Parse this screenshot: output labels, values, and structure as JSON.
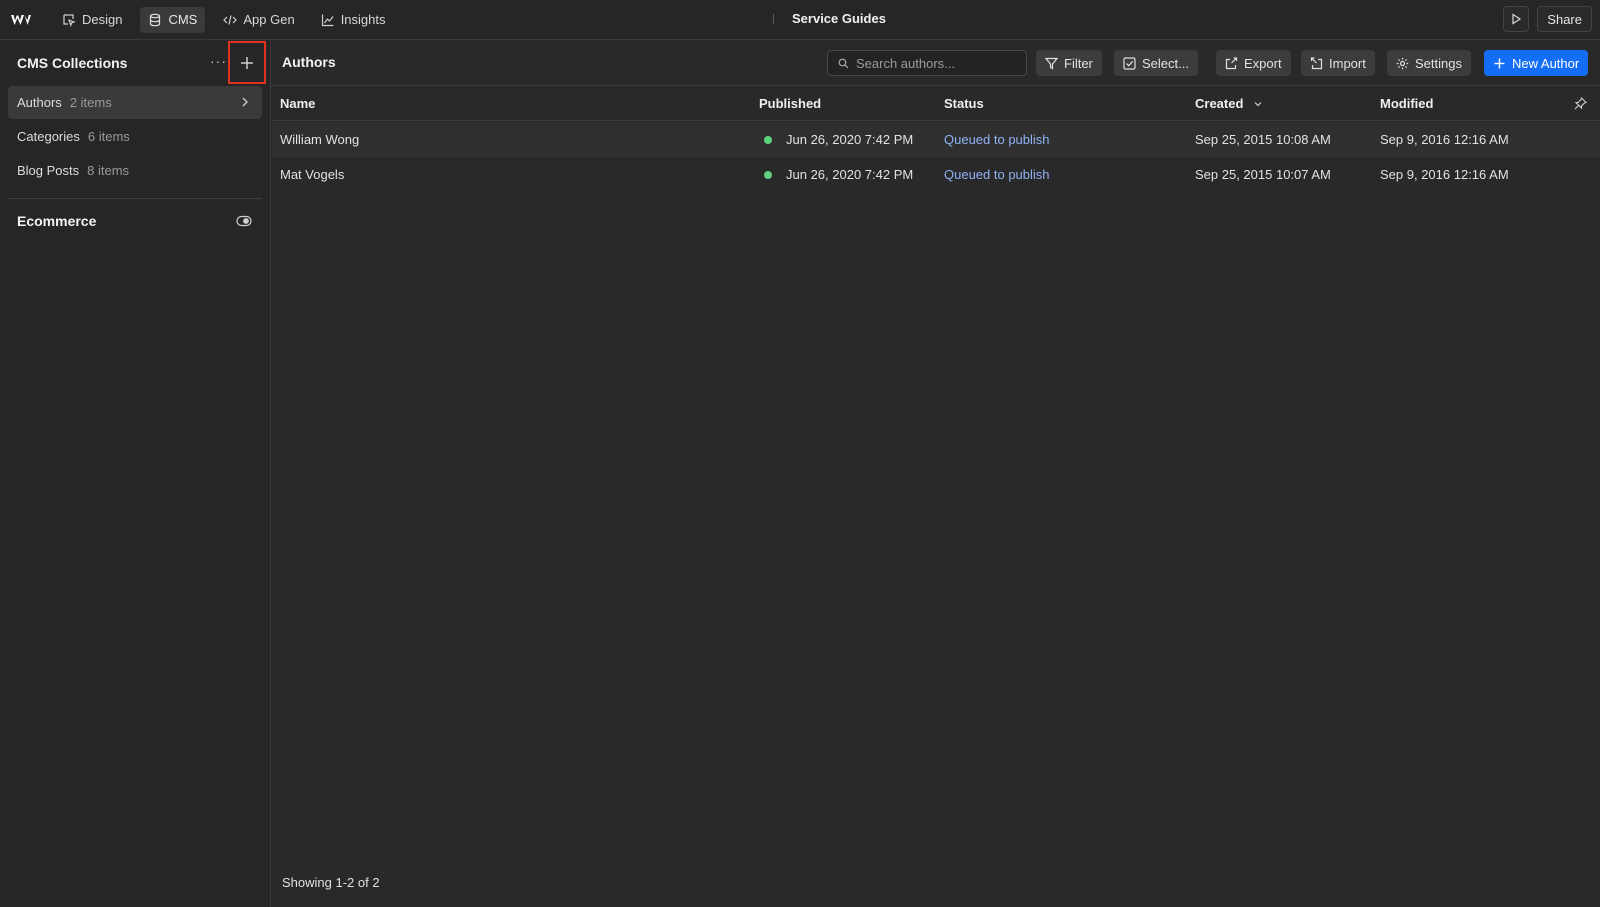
{
  "topbar": {
    "tabs": [
      {
        "label": "Design",
        "icon": "design-cursor-icon"
      },
      {
        "label": "CMS",
        "icon": "database-icon",
        "active": true
      },
      {
        "label": "App Gen",
        "icon": "code-icon"
      },
      {
        "label": "Insights",
        "icon": "chart-icon"
      }
    ],
    "project_title": "Service Guides",
    "share_label": "Share"
  },
  "sidebar": {
    "title": "CMS Collections",
    "more_label": "···",
    "items": [
      {
        "name": "Authors",
        "count": "2 items",
        "active": true
      },
      {
        "name": "Categories",
        "count": "6 items"
      },
      {
        "name": "Blog Posts",
        "count": "8 items"
      }
    ],
    "ecommerce_title": "Ecommerce"
  },
  "main": {
    "title": "Authors",
    "search_placeholder": "Search authors...",
    "toolbar": {
      "filter": "Filter",
      "select": "Select...",
      "export": "Export",
      "import": "Import",
      "settings": "Settings",
      "new_author": "New Author"
    },
    "columns": {
      "name": "Name",
      "published": "Published",
      "status": "Status",
      "created": "Created",
      "modified": "Modified"
    },
    "rows": [
      {
        "name": "William Wong",
        "published": "Jun 26, 2020 7:42 PM",
        "status": "Queued to publish",
        "created": "Sep 25, 2015 10:08 AM",
        "modified": "Sep 9, 2016 12:16 AM"
      },
      {
        "name": "Mat Vogels",
        "published": "Jun 26, 2020 7:42 PM",
        "status": "Queued to publish",
        "created": "Sep 25, 2015 10:07 AM",
        "modified": "Sep 9, 2016 12:16 AM"
      }
    ],
    "footer": "Showing 1-2 of 2"
  },
  "colors": {
    "accent": "#146ef5",
    "status_link": "#8fb2f5",
    "published_dot": "#5fd27f",
    "highlight_box": "#e0321c"
  }
}
